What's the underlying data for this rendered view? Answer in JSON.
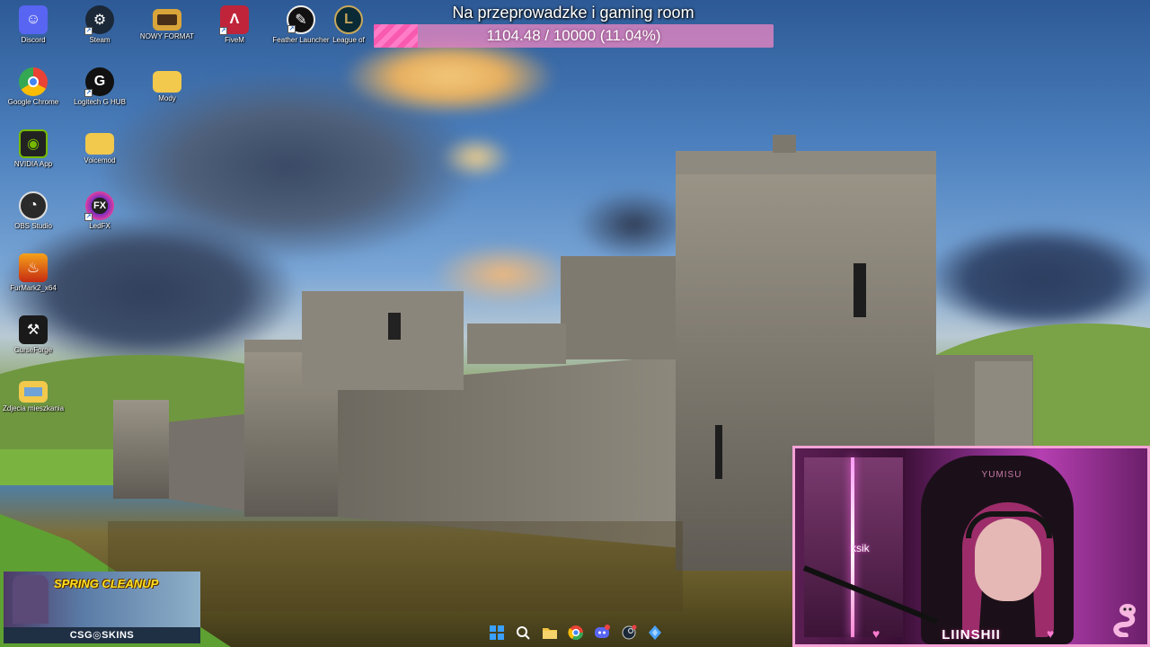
{
  "goal": {
    "title": "Na przeprowadzke i gaming room",
    "progress_text": "1104.48 / 10000 (11.04%)",
    "progress_percent": 11.04,
    "fill_color": "#f85ab0"
  },
  "desktop_icons": [
    {
      "label": "Discord",
      "icon": "discord-icon",
      "color": "#5865f2"
    },
    {
      "label": "Steam",
      "icon": "steam-icon",
      "color": "#1b2838"
    },
    {
      "label": "NOWY FORMAT",
      "icon": "folder-image-icon",
      "color": "#d9a43a"
    },
    {
      "label": "FiveM",
      "icon": "fivem-icon",
      "color": "#c0243a"
    },
    {
      "label": "Feather Launcher",
      "icon": "feather-icon",
      "color": "#111111"
    },
    {
      "label": "League of",
      "icon": "league-icon",
      "color": "#0a2a36"
    },
    {
      "label": "Google Chrome",
      "icon": "chrome-icon",
      "color": "#ffffff"
    },
    {
      "label": "Logitech G HUB",
      "icon": "logitech-ghub-icon",
      "color": "#111111"
    },
    {
      "label": "Mody",
      "icon": "folder-icon",
      "color": "#f2c94c"
    },
    {
      "label": "NVIDIA App",
      "icon": "nvidia-icon",
      "color": "#76b900"
    },
    {
      "label": "Voicemod",
      "icon": "folder-icon",
      "color": "#f2c94c"
    },
    {
      "label": "OBS Studio",
      "icon": "obs-icon",
      "color": "#2a2a2a"
    },
    {
      "label": "LedFX",
      "icon": "ledfx-icon",
      "color": "#7b2cbf"
    },
    {
      "label": "FurMark2_x64",
      "icon": "furmark-icon",
      "color": "#d9481c"
    },
    {
      "label": "CurseForge",
      "icon": "curseforge-icon",
      "color": "#1a1a1a"
    },
    {
      "label": "Zdjecia mieszkania",
      "icon": "folder-image-icon",
      "color": "#f2c94c"
    }
  ],
  "webcam": {
    "name": "LIINSHII",
    "chair_logo": "YUMISU",
    "sign": "ksik"
  },
  "promo": {
    "title": "SPRING CLEANUP",
    "brand": "CSG◎SKINS"
  },
  "taskbar": {
    "items": [
      {
        "icon": "windows-start-icon",
        "label": "⊞"
      },
      {
        "icon": "search-icon",
        "label": "⌕"
      },
      {
        "icon": "file-explorer-icon",
        "label": "▤"
      },
      {
        "icon": "chrome-icon",
        "label": "◎"
      },
      {
        "icon": "discord-icon",
        "label": "☺"
      },
      {
        "icon": "steam-icon",
        "label": "⚙"
      },
      {
        "icon": "app-icon",
        "label": "◆"
      }
    ]
  }
}
